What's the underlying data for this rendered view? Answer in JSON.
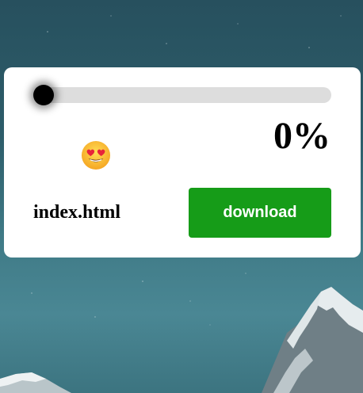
{
  "progress": {
    "percent_label": "0%",
    "value": 0
  },
  "file": {
    "name": "index.html",
    "status_emoji": "heart-eyes-emoji"
  },
  "actions": {
    "download_label": "download"
  },
  "colors": {
    "download_button": "#169c18",
    "track": "#dddddd",
    "thumb": "#000000",
    "card": "#ffffff"
  }
}
